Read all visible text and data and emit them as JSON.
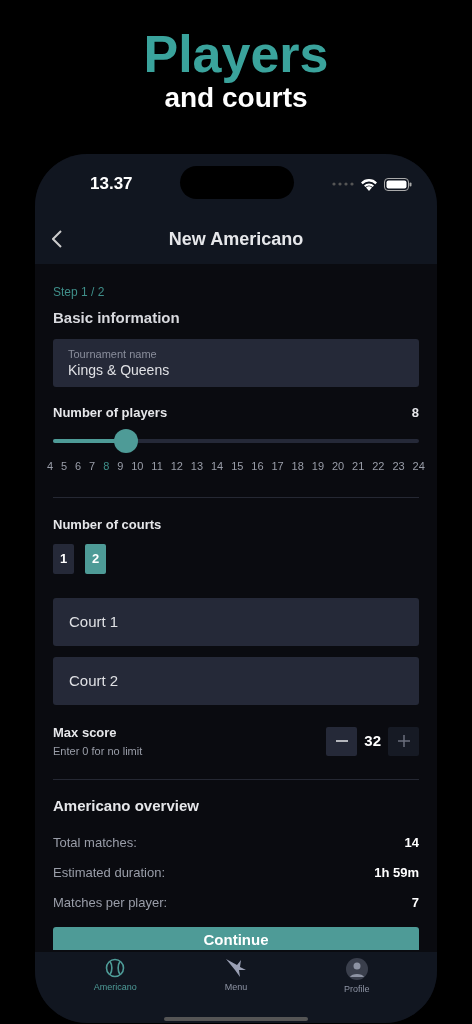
{
  "promo": {
    "title": "Players",
    "subtitle": "and courts"
  },
  "status_bar": {
    "time": "13.37"
  },
  "nav": {
    "title": "New Americano"
  },
  "step": "Step 1 / 2",
  "section_title": "Basic information",
  "tournament_name": {
    "label": "Tournament name",
    "value": "Kings & Queens"
  },
  "players": {
    "label": "Number of players",
    "value": "8",
    "level": 0.2,
    "ticks": [
      {
        "label": "4",
        "selected": false
      },
      {
        "label": "5",
        "selected": false
      },
      {
        "label": "6",
        "selected": false
      },
      {
        "label": "7",
        "selected": false
      },
      {
        "label": "8",
        "selected": true
      },
      {
        "label": "9",
        "selected": false
      },
      {
        "label": "10",
        "selected": false
      },
      {
        "label": "11",
        "selected": false
      },
      {
        "label": "12",
        "selected": false
      },
      {
        "label": "13",
        "selected": false
      },
      {
        "label": "14",
        "selected": false
      },
      {
        "label": "15",
        "selected": false
      },
      {
        "label": "16",
        "selected": false
      },
      {
        "label": "17",
        "selected": false
      },
      {
        "label": "18",
        "selected": false
      },
      {
        "label": "19",
        "selected": false
      },
      {
        "label": "20",
        "selected": false
      },
      {
        "label": "21",
        "selected": false
      },
      {
        "label": "22",
        "selected": false
      },
      {
        "label": "23",
        "selected": false
      },
      {
        "label": "24",
        "selected": false
      }
    ]
  },
  "courts": {
    "label": "Number of courts",
    "options": [
      {
        "label": "1",
        "selected": false
      },
      {
        "label": "2",
        "selected": true
      }
    ],
    "fields": [
      {
        "value": "Court 1"
      },
      {
        "value": "Court 2"
      }
    ]
  },
  "max_score": {
    "label": "Max score",
    "hint": "Enter 0 for no limit",
    "value": "32",
    "buttons": [
      {
        "kind": "decrement",
        "disabled": false
      },
      {
        "kind": "increment",
        "disabled": true
      }
    ]
  },
  "overview": {
    "title": "Americano overview",
    "rows": [
      {
        "label": "Total matches:",
        "value": "14"
      },
      {
        "label": "Estimated duration:",
        "value": "1h 59m"
      },
      {
        "label": "Matches per player:",
        "value": "7"
      }
    ]
  },
  "continue_button": "Continue",
  "tab_bar": [
    {
      "kind": "ball",
      "label": "Americano",
      "selected": true
    },
    {
      "kind": "star",
      "label": "Menu",
      "selected": false
    },
    {
      "kind": "avatar",
      "label": "Profile",
      "selected": false
    }
  ]
}
